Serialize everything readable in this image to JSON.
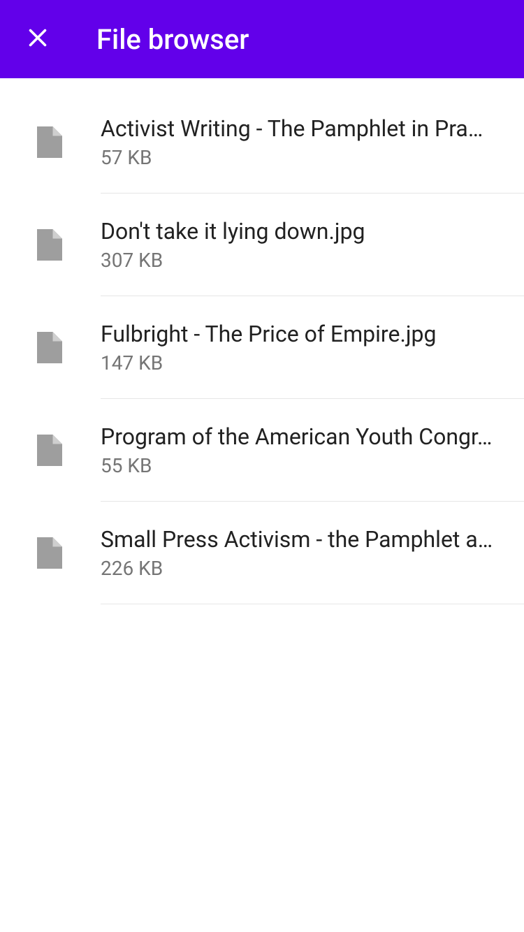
{
  "header": {
    "title": "File browser"
  },
  "files": [
    {
      "name": "Activist Writing - The Pamphlet in Pra…",
      "size": "57 KB"
    },
    {
      "name": "Don't take it lying down.jpg",
      "size": "307 KB"
    },
    {
      "name": "Fulbright - The Price of Empire.jpg",
      "size": "147 KB"
    },
    {
      "name": "Program of the American Youth Congr…",
      "size": "55 KB"
    },
    {
      "name": "Small Press Activism - the Pamphlet a…",
      "size": "226 KB"
    }
  ]
}
